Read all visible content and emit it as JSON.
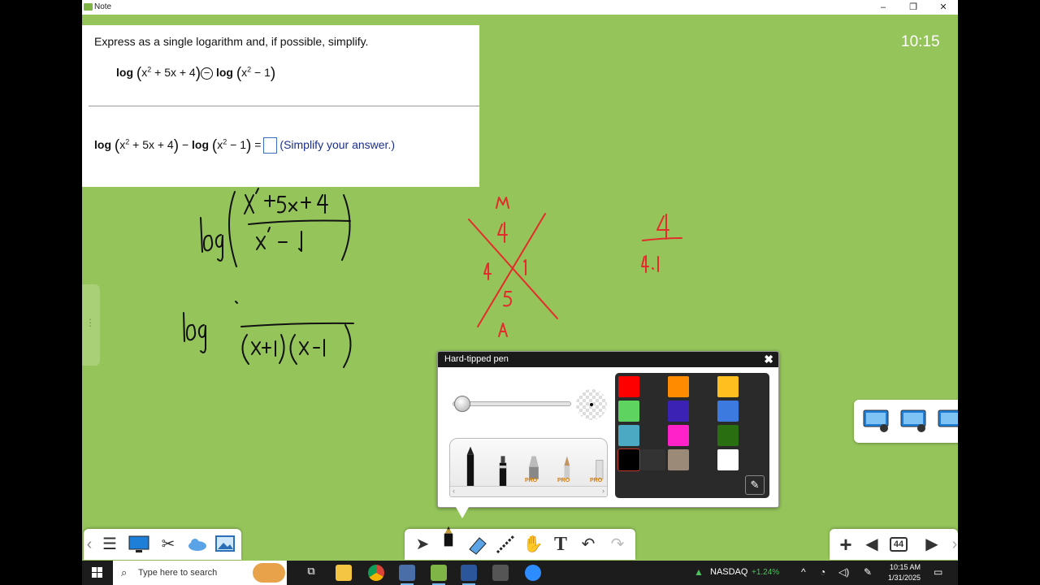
{
  "window": {
    "title": "Note",
    "minimize": "–",
    "restore": "❐",
    "close": "✕"
  },
  "question": {
    "prompt": "Express as a single logarithm and, if possible, simplify.",
    "log_word": "log",
    "expr1_arg1": "x",
    "expr1_exp1": "2",
    "expr1_rest1": " + 5x + 4",
    "expr1_op": "−",
    "expr1_arg2": "x",
    "expr1_exp2": "2",
    "expr1_rest2": " − 1",
    "answer_prefix_minus": "−",
    "equals": "=",
    "answer_hint": "(Simplify your answer.)"
  },
  "clock": "10:15",
  "pen_panel": {
    "title": "Hard-tipped pen",
    "close_icon": "close-icon",
    "pro_label": "PRO",
    "colors": [
      "#ff0000",
      "#ff8c00",
      "#ffbf1f",
      "#5fd35f",
      "#3c22b4",
      "#3c7ae0",
      "#4ca9c4",
      "#ff22c8",
      "#2a6e12",
      "#000000",
      "#333333",
      "#9a8a77",
      "#ffffff"
    ]
  },
  "bottom_toolbar": {
    "left_icons": [
      "menu-icon",
      "display-icon",
      "tools-icon",
      "cloud-icon",
      "image-icon"
    ],
    "center_icons": [
      "select-icon",
      "pen-icon",
      "eraser-icon",
      "line-icon",
      "hand-icon",
      "text-icon",
      "undo-icon",
      "redo-icon"
    ],
    "page_number": "44"
  },
  "taskbar": {
    "search_placeholder": "Type here to search",
    "stock_name": "NASDAQ",
    "stock_change": "+1.24%",
    "time": "10:15 AM",
    "date": "1/31/2025"
  }
}
